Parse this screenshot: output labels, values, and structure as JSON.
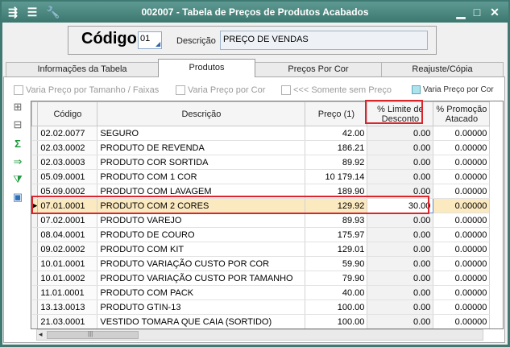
{
  "window": {
    "title": "002007 - Tabela de Preços de Produtos Acabados",
    "icons": [
      "window-menu-icon",
      "list-icon",
      "wrench-icon"
    ],
    "controls": [
      "minimize-icon",
      "maximize-icon",
      "close-icon"
    ]
  },
  "header": {
    "codigo_label": "Código",
    "codigo_value": "01",
    "descricao_label": "Descrição",
    "descricao_value": "PREÇO DE VENDAS"
  },
  "tabs": [
    {
      "label": "Informações da Tabela",
      "active": false
    },
    {
      "label": "Produtos",
      "active": true
    },
    {
      "label": "Preços Por Cor",
      "active": false
    },
    {
      "label": "Reajuste/Cópia",
      "active": false
    }
  ],
  "options": {
    "varia_tamanho": "Varia Preço por Tamanho / Faixas",
    "varia_cor": "Varia Preço por Cor",
    "somente_sem_preco": "<<< Somente sem Preço",
    "legend": "Varia Preço por Cor",
    "legend_color": "#aee3ee"
  },
  "toolbar": [
    "add-row-icon",
    "remove-row-icon",
    "sum-icon",
    "export-icon",
    "filter-icon",
    "image-icon"
  ],
  "grid": {
    "columns": [
      "Código",
      "Descrição",
      "Preço (1)",
      "% Limite de Desconto",
      "% Promoção Atacado"
    ],
    "selected_row": 5,
    "rows": [
      {
        "codigo": "02.02.0077",
        "descricao": "SEGURO",
        "preco": "42.00",
        "limite": "0.00",
        "promocao": "0.00000"
      },
      {
        "codigo": "02.03.0002",
        "descricao": "PRODUTO DE REVENDA",
        "preco": "186.21",
        "limite": "0.00",
        "promocao": "0.00000"
      },
      {
        "codigo": "02.03.0003",
        "descricao": "PRODUTO COR SORTIDA",
        "preco": "89.92",
        "limite": "0.00",
        "promocao": "0.00000"
      },
      {
        "codigo": "05.09.0001",
        "descricao": "PRODUTO COM 1 COR",
        "preco": "10 179.14",
        "limite": "0.00",
        "promocao": "0.00000"
      },
      {
        "codigo": "05.09.0002",
        "descricao": "PRODUTO COM LAVAGEM",
        "preco": "189.90",
        "limite": "0.00",
        "promocao": "0.00000"
      },
      {
        "codigo": "07.01.0001",
        "descricao": "PRODUTO COM 2 CORES",
        "preco": "129.92",
        "limite": "30.00",
        "promocao": "0.00000"
      },
      {
        "codigo": "07.02.0001",
        "descricao": "PRODUTO VAREJO",
        "preco": "89.93",
        "limite": "0.00",
        "promocao": "0.00000"
      },
      {
        "codigo": "08.04.0001",
        "descricao": "PRODUTO DE COURO",
        "preco": "175.97",
        "limite": "0.00",
        "promocao": "0.00000"
      },
      {
        "codigo": "09.02.0002",
        "descricao": "PRODUTO COM KIT",
        "preco": "129.01",
        "limite": "0.00",
        "promocao": "0.00000"
      },
      {
        "codigo": "10.01.0001",
        "descricao": "PRODUTO VARIAÇÃO CUSTO POR COR",
        "preco": "59.90",
        "limite": "0.00",
        "promocao": "0.00000"
      },
      {
        "codigo": "10.01.0002",
        "descricao": "PRODUTO VARIAÇÃO CUSTO POR TAMANHO",
        "preco": "79.90",
        "limite": "0.00",
        "promocao": "0.00000"
      },
      {
        "codigo": "11.01.0001",
        "descricao": "PRODUTO COM PACK",
        "preco": "40.00",
        "limite": "0.00",
        "promocao": "0.00000"
      },
      {
        "codigo": "13.13.0013",
        "descricao": "PRODUTO GTIN-13",
        "preco": "100.00",
        "limite": "0.00",
        "promocao": "0.00000"
      },
      {
        "codigo": "21.03.0001",
        "descricao": "VESTIDO TOMARA QUE CAIA (SORTIDO)",
        "preco": "100.00",
        "limite": "0.00",
        "promocao": "0.00000"
      }
    ]
  },
  "scrollbar": {
    "left_arrow": "◂",
    "grip": "|||"
  },
  "highlight_color": "#d9262d"
}
